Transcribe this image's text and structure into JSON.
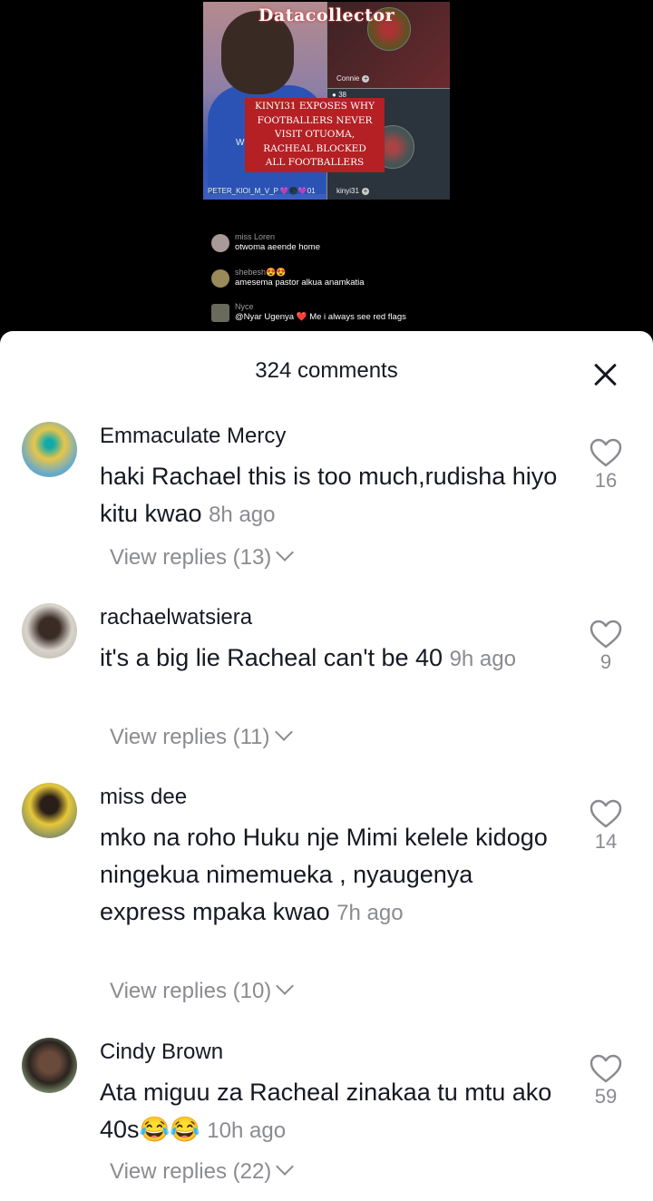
{
  "video": {
    "watermark": "Datacollector",
    "headline_lines": [
      "KINYI31 EXPOSES WHY",
      "FOOTBALLERS NEVER",
      "VISIT OTUOMA,",
      "RACHEAL BLOCKED",
      "ALL FOOTBALLERS"
    ],
    "host_label": "PETER_KIOI_M_V_P 💜🌑💜01",
    "guest1_label": "Connie",
    "guest1_count": "38",
    "guest2_label": "kinyi31",
    "partial_label": "W∃",
    "live_comments": [
      {
        "name": "miss Loren",
        "text": "otwoma aeende home"
      },
      {
        "name": "shebesh😍😍",
        "text": "amesema pastor alkua anamkatia"
      },
      {
        "name": "Nyce",
        "text": "@Nyar Ugenya ❤️ Me i always see red flags"
      }
    ]
  },
  "sheet": {
    "title": "324 comments",
    "comments": [
      {
        "user": "Emmaculate Mercy",
        "text": "haki Rachael this is too much,rudisha hiyo kitu kwao",
        "time": "8h ago",
        "replies": "View replies (13)",
        "likes": "16"
      },
      {
        "user": "rachaelwatsiera",
        "text": "it's a big lie Racheal can't be 40",
        "time": "9h ago",
        "replies": "View replies (11)",
        "likes": "9"
      },
      {
        "user": "miss dee",
        "text": "mko na roho Huku nje Mimi kelele kidogo ningekua nimemueka , nyaugenya express mpaka kwao",
        "time": "7h ago",
        "replies": "View replies (10)",
        "likes": "14"
      },
      {
        "user": "Cindy Brown",
        "text": "Ata miguu za Racheal zinakaa tu mtu ako 40s😂😂",
        "time": "10h ago",
        "replies": "View replies (22)",
        "likes": "59"
      }
    ]
  },
  "icons": {
    "close": "close-icon",
    "like": "heart-outline-icon",
    "expand": "chevron-down-icon"
  }
}
